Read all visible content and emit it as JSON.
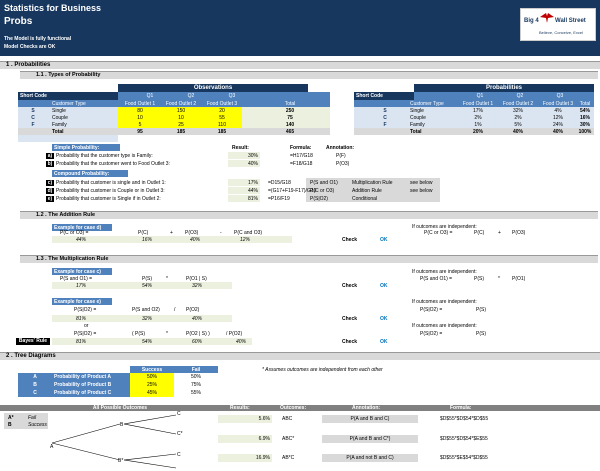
{
  "header": {
    "title": "Statistics for Business",
    "subtitle": "Probs",
    "status1": "The Model is fully functional",
    "status2": "Model Checks are OK"
  },
  "logo": {
    "left": "Big 4",
    "right": "Wall Street",
    "tagline": "Believe, Conceive, Excel"
  },
  "sections": {
    "s1": "1 . Probabilities",
    "s11": "1.1 . Types of Probability",
    "s12": "1.2 . The Addition Rule",
    "s13": "1.3 . The Multiplication Rule",
    "s2": "2 . Tree Diagrams"
  },
  "observations": {
    "title": "Observations",
    "short_code": "Short Code",
    "customer_type": "Customer Type",
    "q_headers": [
      "Q1",
      "Q2",
      "Q3"
    ],
    "outlets": [
      "Food Outlet 1",
      "Food Outlet 2",
      "Food Outlet 3",
      "Total"
    ],
    "rows": [
      {
        "code": "S",
        "type": "Single",
        "v": [
          "80",
          "150",
          "20",
          "250"
        ]
      },
      {
        "code": "C",
        "type": "Couple",
        "v": [
          "10",
          "10",
          "55",
          "75"
        ]
      },
      {
        "code": "F",
        "type": "Family",
        "v": [
          "5",
          "25",
          "110",
          "140"
        ]
      },
      {
        "code": "",
        "type": "Total",
        "v": [
          "95",
          "185",
          "185",
          "465"
        ]
      }
    ]
  },
  "probabilities": {
    "title": "Probabilities",
    "short_code": "Short Code",
    "customer_type": "Customer Type",
    "q_headers": [
      "Q1",
      "Q2",
      "Q3"
    ],
    "outlets": [
      "Food Outlet 1",
      "Food Outlet 2",
      "Food Outlet 3",
      "Total"
    ],
    "rows": [
      {
        "code": "S",
        "type": "Single",
        "v": [
          "17%",
          "32%",
          "4%",
          "54%"
        ]
      },
      {
        "code": "C",
        "type": "Couple",
        "v": [
          "2%",
          "2%",
          "12%",
          "16%"
        ]
      },
      {
        "code": "F",
        "type": "Family",
        "v": [
          "1%",
          "5%",
          "24%",
          "30%"
        ]
      },
      {
        "code": "",
        "type": "Total",
        "v": [
          "20%",
          "40%",
          "40%",
          "100%"
        ]
      }
    ]
  },
  "simple": {
    "title": "Simple Probability:",
    "result_h": "Result:",
    "formula_h": "Formula:",
    "annotation_h": "Annotation:",
    "rows": [
      {
        "k": "a)",
        "text": "Probability that the customer type is Family:",
        "res": "30%",
        "f": "=H17/G18",
        "a": "P(F)"
      },
      {
        "k": "b)",
        "text": "Probability that the customer went to Food Outlet 3:",
        "res": "40%",
        "f": "=F18/G18",
        "a": "P(O3)"
      }
    ]
  },
  "compound": {
    "title": "Compound Probability:",
    "rows": [
      {
        "k": "c)",
        "text": "Probability that customer is single and in Outlet 1:",
        "res": "17%",
        "f": "=D15/G18",
        "a": "P(S and O1)",
        "n": "Multiplication Rule",
        "s": "see below"
      },
      {
        "k": "d)",
        "text": "Probability that customer is Couple or in Outlet 3:",
        "res": "44%",
        "f": "=(G17+F19-F17)/G19",
        "a": "P(C or O3)",
        "n": "Addition Rule",
        "s": "see below"
      },
      {
        "k": "e)",
        "text": "Probability that customer is Single if in Outlet 2:",
        "res": "81%",
        "f": "=P16/F19",
        "a": "P(S|O2)",
        "n": "Conditional",
        "s": ""
      }
    ]
  },
  "addition": {
    "example": "Example for case d)",
    "eq": [
      "P(C or O3) =",
      "P(C)",
      "+",
      "P(O3)",
      "-",
      "P(C and O3)"
    ],
    "vals": [
      "44%",
      "16%",
      "40%",
      "12%"
    ],
    "check": "Check",
    "ok": "OK",
    "indep": "If outcomes are independent:",
    "indep_eq": [
      "P(C or O3) =",
      "P(C)",
      "+",
      "P(O3)"
    ]
  },
  "mult": {
    "example_c": "Example for case c)",
    "eq_c": [
      "P(S and O1) =",
      "P(S)",
      "*",
      "P(O1 | S)"
    ],
    "vals_c": [
      "17%",
      "54%",
      "32%"
    ],
    "example_e": "Example for case e)",
    "eq_e": [
      "P(S|O2) =",
      "P(S and O2)",
      "/",
      "P(O2)"
    ],
    "vals_e": [
      "81%",
      "32%",
      "40%"
    ],
    "or": "or",
    "eq_b": [
      "P(S|O2) =",
      "( P(S)",
      "*",
      "P(O2 | S) )",
      "/ P(O2)"
    ],
    "bayes": "Bayes' Rule",
    "vals_b": [
      "81%",
      "54%",
      "60%",
      "40%"
    ],
    "check": "Check",
    "ok": "OK",
    "indep": "If outcomes are independent:",
    "ind_c": [
      "P(S and O1) =",
      "P(S)",
      "*",
      "P(O1)"
    ],
    "ind_e": [
      "P(S|O2) =",
      "P(S)"
    ],
    "ind_b": [
      "P(S|O2) =",
      "P(S)"
    ]
  },
  "tree": {
    "success": "Success",
    "fail": "Fail",
    "note": "* Assumes outcomes are independent from each other",
    "rows": [
      {
        "k": "A",
        "label": "Probability of Product A",
        "s": "50%",
        "f": "50%"
      },
      {
        "k": "B",
        "label": "Probability of Product B",
        "s": "25%",
        "f": "75%"
      },
      {
        "k": "C",
        "label": "Probability of Product C",
        "s": "45%",
        "f": "55%"
      }
    ],
    "outcomes_h": "All Possible Outcomes",
    "results_h": "Results:",
    "outcomes_col_h": "Outcomes:",
    "annotation_h": "Annotation:",
    "formula_h": "Formula:",
    "legend": [
      {
        "k": "A*",
        "v": "Fail"
      },
      {
        "k": "B",
        "v": "Success"
      }
    ],
    "nodes": [
      "A",
      "B",
      "B*",
      "C",
      "C*",
      "C"
    ],
    "out_rows": [
      {
        "res": "5.6%",
        "o": "ABC",
        "a": "P(A and B and C)",
        "f": "$D$55*$D$54*$D$55"
      },
      {
        "res": "6.9%",
        "o": "ABC*",
        "a": "P(A and B and C*)",
        "f": "$D$55*$D$54*$E$55"
      },
      {
        "res": "16.9%",
        "o": "AB*C",
        "a": "P(A and not B and C)",
        "f": "$D$55*$E$54*$D$55"
      }
    ]
  }
}
